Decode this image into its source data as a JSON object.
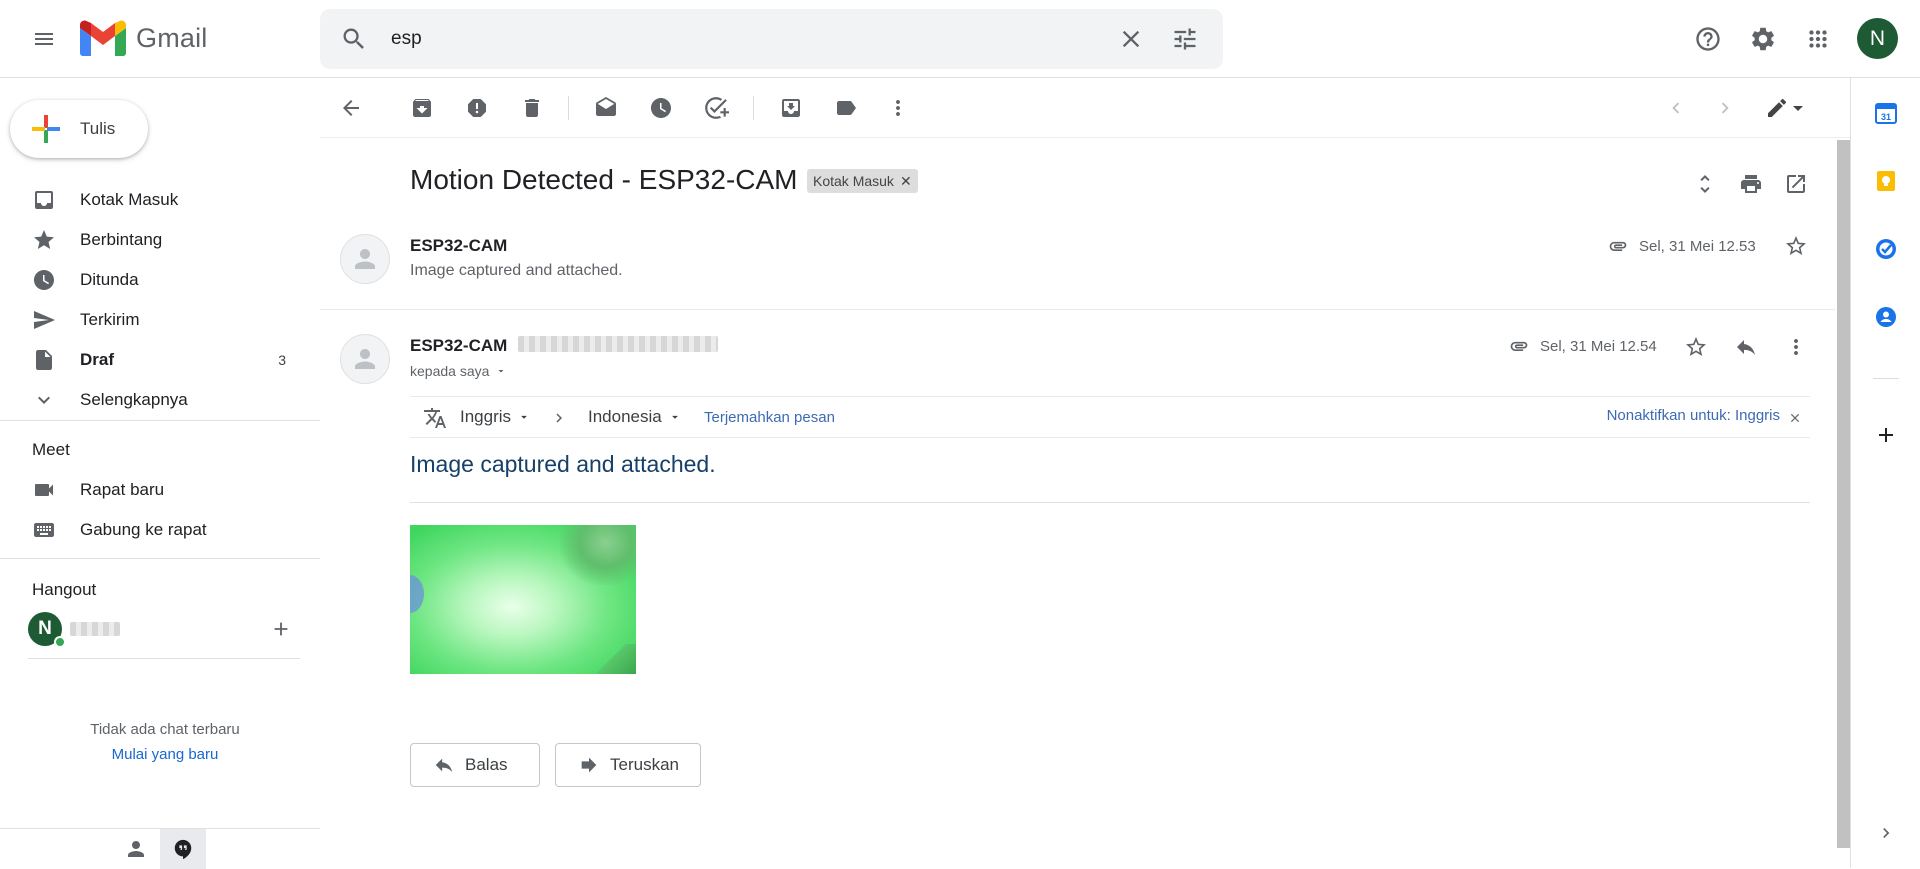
{
  "app": {
    "name": "Gmail"
  },
  "search": {
    "value": "esp"
  },
  "header": {
    "avatar_initial": "N"
  },
  "compose": {
    "label": "Tulis"
  },
  "nav": {
    "items": [
      {
        "label": "Kotak Masuk",
        "count": ""
      },
      {
        "label": "Berbintang",
        "count": ""
      },
      {
        "label": "Ditunda",
        "count": ""
      },
      {
        "label": "Terkirim",
        "count": ""
      },
      {
        "label": "Draf",
        "count": "3"
      },
      {
        "label": "Selengkapnya",
        "count": ""
      }
    ]
  },
  "meet": {
    "title": "Meet",
    "items": [
      {
        "label": "Rapat baru"
      },
      {
        "label": "Gabung ke rapat"
      }
    ]
  },
  "hangout": {
    "title": "Hangout",
    "avatar_initial": "N",
    "no_chat": "Tidak ada chat terbaru",
    "start_new": "Mulai yang baru"
  },
  "thread": {
    "subject": "Motion Detected - ESP32-CAM",
    "label": "Kotak Masuk",
    "messages": [
      {
        "sender": "ESP32-CAM",
        "snippet": "Image captured and attached.",
        "date": "Sel, 31 Mei 12.53"
      },
      {
        "sender": "ESP32-CAM",
        "to": "kepada saya",
        "date": "Sel, 31 Mei 12.54",
        "body": "Image captured and attached."
      }
    ]
  },
  "translate": {
    "source": "Inggris",
    "target": "Indonesia",
    "action": "Terjemahkan pesan",
    "disable": "Nonaktifkan untuk: Inggris"
  },
  "actions": {
    "reply": "Balas",
    "forward": "Teruskan"
  },
  "colors": {
    "accent": "#1967d2",
    "avatar": "#1e5a33",
    "online": "#34a853"
  }
}
